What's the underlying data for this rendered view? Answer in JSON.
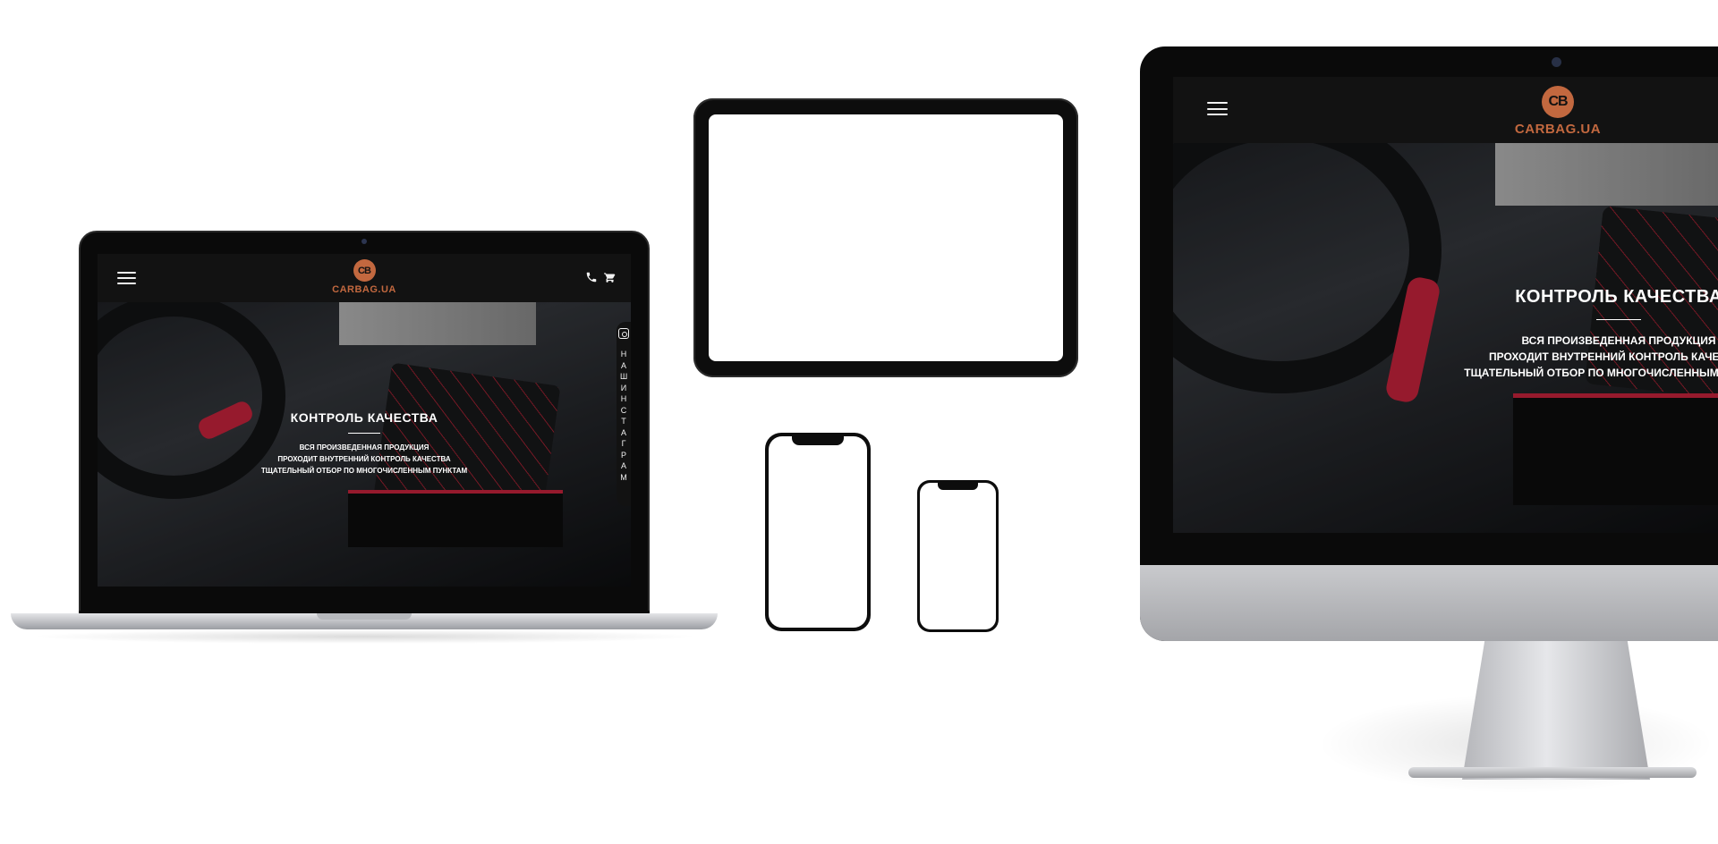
{
  "site": {
    "logo_mark": "CB",
    "logo_text": "CARBAG.UA",
    "brand_color": "#c2683f",
    "hero": {
      "title": "КОНТРОЛЬ КАЧЕСТВА",
      "lines": [
        "ВСЯ ПРОИЗВЕДЕННАЯ ПРОДУКЦИЯ",
        "ПРОХОДИТ ВНУТРЕННИЙ КОНТРОЛЬ КАЧЕСТВА",
        "ТЩАТЕЛЬНЫЙ ОТБОР ПО МНОГОЧИСЛЕННЫМ ПУНКТАМ"
      ]
    },
    "instagram_label": "НАШ ИНСТАГРАМ",
    "icons": [
      "menu-icon",
      "phone-icon",
      "cart-icon",
      "instagram-icon"
    ]
  }
}
